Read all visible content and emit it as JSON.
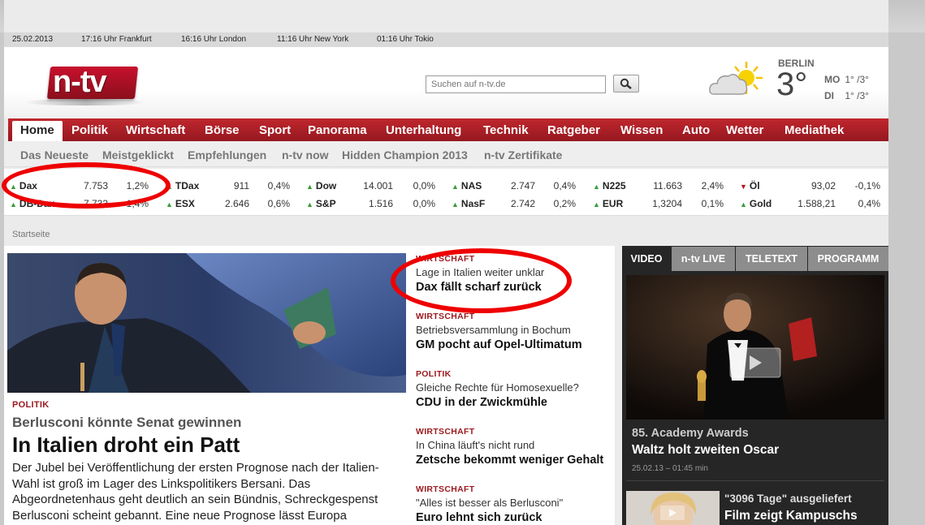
{
  "timebar": {
    "date": "25.02.2013",
    "frankfurt": "17:16 Uhr Frankfurt",
    "london": "16:16 Uhr London",
    "newyork": "11:16 Uhr New York",
    "tokio": "01:16 Uhr Tokio"
  },
  "header": {
    "logo_text": "n-tv",
    "search_placeholder": "Suchen auf n-tv.de",
    "weather": {
      "icon": "sun-cloud-icon",
      "city": "BERLIN",
      "temperature": "3°",
      "forecast": [
        {
          "day": "MO",
          "temps": "1° /3°"
        },
        {
          "day": "DI",
          "temps": "1° /3°"
        }
      ]
    }
  },
  "nav": {
    "items": [
      "Home",
      "Politik",
      "Wirtschaft",
      "Börse",
      "Sport",
      "Panorama",
      "Unterhaltung",
      "Technik",
      "Ratgeber",
      "Wissen",
      "Auto",
      "Wetter",
      "Mediathek"
    ],
    "active": "Home"
  },
  "subnav": {
    "items": [
      "Das Neueste",
      "Meistgeklickt",
      "Empfehlungen",
      "n-tv now",
      "Hidden Champion 2013",
      "n-tv Zertifikate"
    ]
  },
  "ticker": [
    {
      "name": "Dax",
      "value": "7.753",
      "change": "1,2%",
      "trend": "up"
    },
    {
      "name": "DB-Dax",
      "value": "7.733",
      "change": "1,4%",
      "trend": "up"
    },
    {
      "name": "TDax",
      "value": "911",
      "change": "0,4%",
      "trend": "up"
    },
    {
      "name": "ESX",
      "value": "2.646",
      "change": "0,6%",
      "trend": "up"
    },
    {
      "name": "Dow",
      "value": "14.001",
      "change": "0,0%",
      "trend": "up"
    },
    {
      "name": "S&P",
      "value": "1.516",
      "change": "0,0%",
      "trend": "up"
    },
    {
      "name": "NAS",
      "value": "2.747",
      "change": "0,4%",
      "trend": "up"
    },
    {
      "name": "NasF",
      "value": "2.742",
      "change": "0,2%",
      "trend": "up"
    },
    {
      "name": "N225",
      "value": "11.663",
      "change": "2,4%",
      "trend": "up"
    },
    {
      "name": "EUR",
      "value": "1,3204",
      "change": "0,1%",
      "trend": "up"
    },
    {
      "name": "Öl",
      "value": "93,02",
      "change": "-0,1%",
      "trend": "down"
    },
    {
      "name": "Gold",
      "value": "1.588,21",
      "change": "0,4%",
      "trend": "up"
    }
  ],
  "breadcrumb": "Startseite",
  "lead": {
    "kicker": "POLITIK",
    "subtitle": "Berlusconi könnte Senat gewinnen",
    "title": "In Italien droht ein Patt",
    "text": "Der Jubel bei Veröffentlichung der ersten Prognose nach der Italien-Wahl ist groß im Lager des Linkspolitikers Bersani. Das Abgeordnetenhaus geht deutlich an sein Bündnis, Schreckgespenst Berlusconi scheint gebannt. Eine neue Prognose lässt Europa"
  },
  "stories": [
    {
      "kicker": "WIRTSCHAFT",
      "sub": "Lage in Italien weiter unklar",
      "title": "Dax fällt scharf zurück"
    },
    {
      "kicker": "WIRTSCHAFT",
      "sub": "Betriebsversammlung in Bochum",
      "title": "GM pocht auf Opel-Ultimatum"
    },
    {
      "kicker": "POLITIK",
      "sub": "Gleiche Rechte für Homosexuelle?",
      "title": "CDU in der Zwickmühle"
    },
    {
      "kicker": "WIRTSCHAFT",
      "sub": "In China läuft's nicht rund",
      "title": "Zetsche bekommt weniger Gehalt"
    },
    {
      "kicker": "WIRTSCHAFT",
      "sub": "\"Alles ist besser als Berlusconi\"",
      "title": "Euro lehnt sich zurück"
    }
  ],
  "sidebar": {
    "tabs": [
      "VIDEO",
      "n-tv LIVE",
      "TELETEXT",
      "PROGRAMM"
    ],
    "active_tab": "VIDEO",
    "feature": {
      "sub": "85. Academy Awards",
      "title": "Waltz holt zweiten Oscar",
      "time": "25.02.13 – 01:45 min"
    },
    "second": {
      "sub": "\"3096 Tage\" ausgeliefert",
      "title": "Film zeigt Kampuschs"
    }
  },
  "colors": {
    "brand_red": "#c0272d",
    "positive": "#3a9c3a",
    "negative": "#c81d25",
    "annotation": "#ee0000"
  }
}
